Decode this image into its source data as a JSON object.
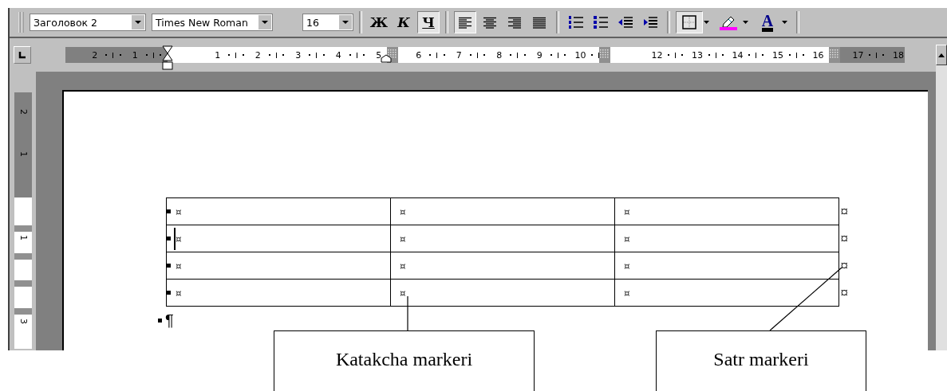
{
  "toolbar": {
    "style_box": {
      "value": "Заголовок 2"
    },
    "font_box": {
      "value": "Times New Roman"
    },
    "size_box": {
      "value": "16"
    },
    "format_buttons": [
      {
        "kind": "bold",
        "label": "Ж",
        "selected": false
      },
      {
        "kind": "italic",
        "label": "К",
        "selected": false
      },
      {
        "kind": "underline",
        "label": "Ч",
        "selected": true
      }
    ],
    "align_buttons": [
      {
        "kind": "left",
        "selected": true
      },
      {
        "kind": "center",
        "selected": false
      },
      {
        "kind": "right",
        "selected": false
      },
      {
        "kind": "justify",
        "selected": false
      }
    ],
    "list_buttons": [
      {
        "kind": "numbered"
      },
      {
        "kind": "bulleted"
      },
      {
        "kind": "outdent"
      },
      {
        "kind": "indent"
      }
    ],
    "borders_button": {
      "selected": true
    },
    "font_color_button": {
      "label": "A"
    }
  },
  "ruler": {
    "segments": [
      {
        "shaded": true,
        "labels": [
          "2",
          "1"
        ]
      },
      {
        "shaded": false,
        "labels": [
          "1",
          "2",
          "3",
          "4",
          "5"
        ]
      },
      {
        "shaded": false,
        "labels": [
          "6",
          "7",
          "8",
          "9",
          "10"
        ]
      },
      {
        "shaded": false,
        "labels": [
          "12",
          "13",
          "14",
          "15",
          "16"
        ]
      },
      {
        "shaded": true,
        "labels": [
          "17",
          "18"
        ]
      }
    ]
  },
  "vertical_ruler": {
    "segments": [
      {
        "shaded": true,
        "labels": [
          "2",
          "1"
        ]
      },
      {
        "shaded": false,
        "labels": [
          "1",
          "3"
        ]
      }
    ]
  },
  "table": {
    "rows": [
      {
        "cells": [
          "¤",
          "¤",
          "¤"
        ],
        "row_end": "¤",
        "cursor": false
      },
      {
        "cells": [
          "¤",
          "¤",
          "¤"
        ],
        "row_end": "¤",
        "cursor": true
      },
      {
        "cells": [
          "¤",
          "¤",
          "¤"
        ],
        "row_end": "¤",
        "cursor": false
      },
      {
        "cells": [
          "¤",
          "¤",
          "¤"
        ],
        "row_end": "¤",
        "cursor": false
      }
    ]
  },
  "paragraph_mark": "¶",
  "callouts": [
    {
      "text": "Katakcha markeri"
    },
    {
      "text": "Satr markeri"
    }
  ]
}
